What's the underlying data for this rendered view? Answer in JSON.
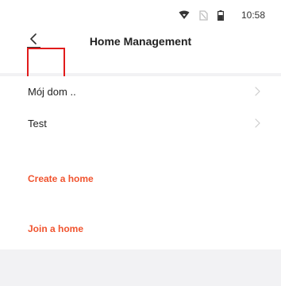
{
  "status_bar": {
    "time": "10:58",
    "icons": [
      "wifi-icon",
      "no-sim-icon",
      "battery-icon"
    ]
  },
  "header": {
    "title": "Home Management",
    "back_icon": "chevron-left-icon"
  },
  "homes": [
    {
      "label": "Mój dom ..",
      "icon": "chevron-right-icon"
    },
    {
      "label": "Test",
      "icon": "chevron-right-icon"
    }
  ],
  "actions": {
    "create_label": "Create a home",
    "join_label": "Join a home"
  },
  "colors": {
    "accent": "#f0532e",
    "highlight": "#e11b1b",
    "background": "#f2f2f4",
    "card": "#ffffff"
  }
}
